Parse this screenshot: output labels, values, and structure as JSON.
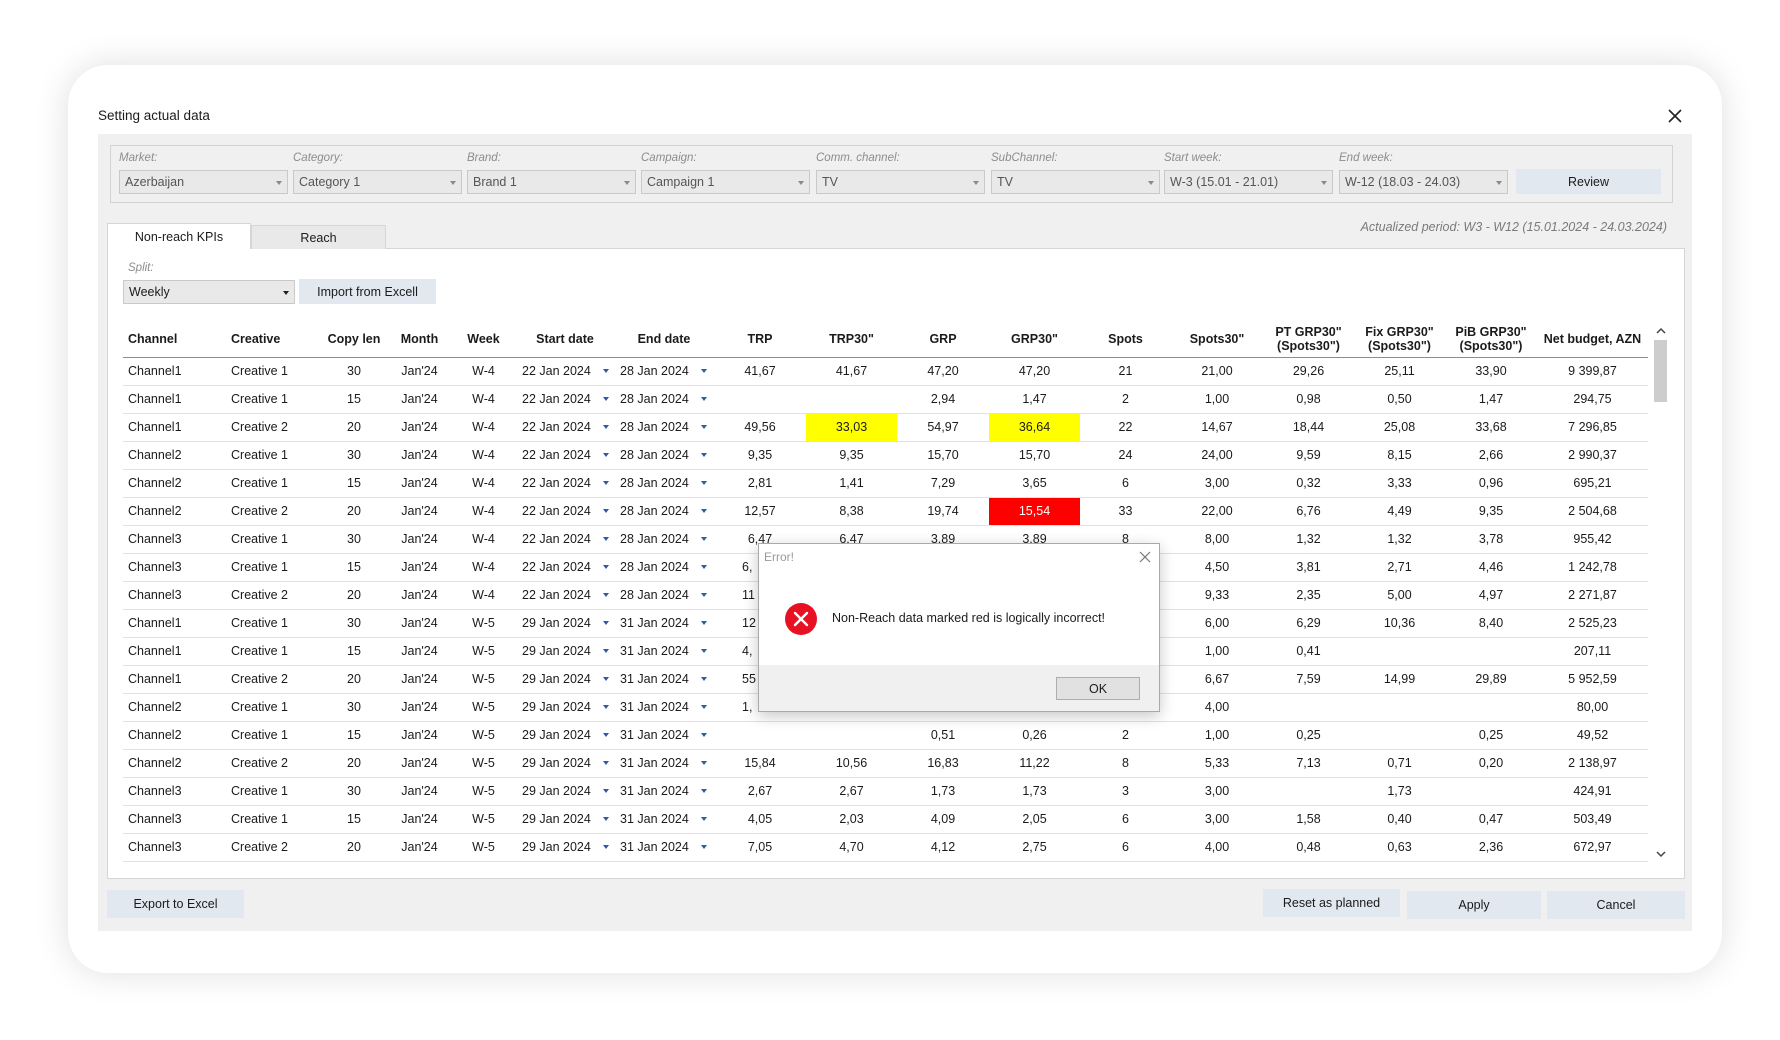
{
  "window": {
    "title": "Setting actual data"
  },
  "filters": [
    {
      "label": "Market:",
      "value": "Azerbaijan"
    },
    {
      "label": "Category:",
      "value": "Category 1"
    },
    {
      "label": "Brand:",
      "value": "Brand 1"
    },
    {
      "label": "Campaign:",
      "value": "Campaign 1"
    },
    {
      "label": "Comm. channel:",
      "value": "TV"
    },
    {
      "label": "SubChannel:",
      "value": "TV"
    },
    {
      "label": "Start week:",
      "value": "W-3 (15.01 - 21.01)"
    },
    {
      "label": "End week:",
      "value": "W-12 (18.03 - 24.03)"
    }
  ],
  "review_label": "Review",
  "tabs": [
    {
      "label": "Non-reach KPIs",
      "active": true
    },
    {
      "label": "Reach",
      "active": false
    }
  ],
  "actualized_period": "Actualized period: W3 - W12 (15.01.2024 - 24.03.2024)",
  "split": {
    "label": "Split:",
    "value": "Weekly"
  },
  "import_label": "Import from Excell",
  "table": {
    "columns": [
      "Channel",
      "Creative",
      "Copy len",
      "Month",
      "Week",
      "Start date",
      "End date",
      "TRP",
      "TRP30\"",
      "GRP",
      "GRP30\"",
      "Spots",
      "Spots30\"",
      "PT GRP30\"\n(Spots30\")",
      "Fix GRP30\"\n(Spots30\")",
      "PiB GRP30\"\n(Spots30\")",
      "Net budget, AZN"
    ],
    "rows": [
      [
        "Channel1",
        "Creative 1",
        "30",
        "Jan'24",
        "W-4",
        "22 Jan 2024",
        "28 Jan 2024",
        "41,67",
        "41,67",
        "47,20",
        "47,20",
        "21",
        "21,00",
        "29,26",
        "25,11",
        "33,90",
        "9 399,87"
      ],
      [
        "Channel1",
        "Creative 1",
        "15",
        "Jan'24",
        "W-4",
        "22 Jan 2024",
        "28 Jan 2024",
        "",
        "",
        "2,94",
        "1,47",
        "2",
        "1,00",
        "0,98",
        "0,50",
        "1,47",
        "294,75"
      ],
      [
        "Channel1",
        "Creative 2",
        "20",
        "Jan'24",
        "W-4",
        "22 Jan 2024",
        "28 Jan 2024",
        "49,56",
        "33,03",
        "54,97",
        "36,64",
        "22",
        "14,67",
        "18,44",
        "25,08",
        "33,68",
        "7 296,85"
      ],
      [
        "Channel2",
        "Creative 1",
        "30",
        "Jan'24",
        "W-4",
        "22 Jan 2024",
        "28 Jan 2024",
        "9,35",
        "9,35",
        "15,70",
        "15,70",
        "24",
        "24,00",
        "9,59",
        "8,15",
        "2,66",
        "2 990,37"
      ],
      [
        "Channel2",
        "Creative 1",
        "15",
        "Jan'24",
        "W-4",
        "22 Jan 2024",
        "28 Jan 2024",
        "2,81",
        "1,41",
        "7,29",
        "3,65",
        "6",
        "3,00",
        "0,32",
        "3,33",
        "0,96",
        "695,21"
      ],
      [
        "Channel2",
        "Creative 2",
        "20",
        "Jan'24",
        "W-4",
        "22 Jan 2024",
        "28 Jan 2024",
        "12,57",
        "8,38",
        "19,74",
        "15,54",
        "33",
        "22,00",
        "6,76",
        "4,49",
        "9,35",
        "2 504,68"
      ],
      [
        "Channel3",
        "Creative 1",
        "30",
        "Jan'24",
        "W-4",
        "22 Jan 2024",
        "28 Jan 2024",
        "6,47",
        "6,47",
        "3,89",
        "3,89",
        "8",
        "8,00",
        "1,32",
        "1,32",
        "3,78",
        "955,42"
      ],
      [
        "Channel3",
        "Creative 1",
        "15",
        "Jan'24",
        "W-4",
        "22 Jan 2024",
        "28 Jan 2024",
        "6,",
        "",
        "",
        "",
        "",
        "4,50",
        "3,81",
        "2,71",
        "4,46",
        "1 242,78"
      ],
      [
        "Channel3",
        "Creative 2",
        "20",
        "Jan'24",
        "W-4",
        "22 Jan 2024",
        "28 Jan 2024",
        "11",
        "",
        "",
        "",
        "",
        "9,33",
        "2,35",
        "5,00",
        "4,97",
        "2 271,87"
      ],
      [
        "Channel1",
        "Creative 1",
        "30",
        "Jan'24",
        "W-5",
        "29 Jan 2024",
        "31 Jan 2024",
        "12",
        "",
        "",
        "",
        "",
        "6,00",
        "6,29",
        "10,36",
        "8,40",
        "2 525,23"
      ],
      [
        "Channel1",
        "Creative 1",
        "15",
        "Jan'24",
        "W-5",
        "29 Jan 2024",
        "31 Jan 2024",
        "4,",
        "",
        "",
        "",
        "",
        "1,00",
        "0,41",
        "",
        "",
        "207,11"
      ],
      [
        "Channel1",
        "Creative 2",
        "20",
        "Jan'24",
        "W-5",
        "29 Jan 2024",
        "31 Jan 2024",
        "55",
        "",
        "",
        "",
        "",
        "6,67",
        "7,59",
        "14,99",
        "29,89",
        "5 952,59"
      ],
      [
        "Channel2",
        "Creative 1",
        "30",
        "Jan'24",
        "W-5",
        "29 Jan 2024",
        "31 Jan 2024",
        "1,",
        "",
        "",
        "",
        "",
        "4,00",
        "",
        "",
        "",
        "80,00"
      ],
      [
        "Channel2",
        "Creative 1",
        "15",
        "Jan'24",
        "W-5",
        "29 Jan 2024",
        "31 Jan 2024",
        "",
        "",
        "0,51",
        "0,26",
        "2",
        "1,00",
        "0,25",
        "",
        "0,25",
        "49,52"
      ],
      [
        "Channel2",
        "Creative 2",
        "20",
        "Jan'24",
        "W-5",
        "29 Jan 2024",
        "31 Jan 2024",
        "15,84",
        "10,56",
        "16,83",
        "11,22",
        "8",
        "5,33",
        "7,13",
        "0,71",
        "0,20",
        "2 138,97"
      ],
      [
        "Channel3",
        "Creative 1",
        "30",
        "Jan'24",
        "W-5",
        "29 Jan 2024",
        "31 Jan 2024",
        "2,67",
        "2,67",
        "1,73",
        "1,73",
        "3",
        "3,00",
        "",
        "1,73",
        "",
        "424,91"
      ],
      [
        "Channel3",
        "Creative 1",
        "15",
        "Jan'24",
        "W-5",
        "29 Jan 2024",
        "31 Jan 2024",
        "4,05",
        "2,03",
        "4,09",
        "2,05",
        "6",
        "3,00",
        "1,58",
        "0,40",
        "0,47",
        "503,49"
      ],
      [
        "Channel3",
        "Creative 2",
        "20",
        "Jan'24",
        "W-5",
        "29 Jan 2024",
        "31 Jan 2024",
        "7,05",
        "4,70",
        "4,12",
        "2,75",
        "6",
        "4,00",
        "0,48",
        "0,63",
        "2,36",
        "672,97"
      ]
    ]
  },
  "highlights": [
    {
      "row": 2,
      "col": 8,
      "color": "yellow"
    },
    {
      "row": 2,
      "col": 10,
      "color": "yellow"
    },
    {
      "row": 5,
      "col": 10,
      "color": "red"
    }
  ],
  "colors": {
    "yellow": "#ffff00",
    "red": "#ff0000",
    "error_icon": "#e81123"
  },
  "error_dialog": {
    "title": "Error!",
    "message": "Non-Reach data marked red is logically incorrect!",
    "ok_label": "OK"
  },
  "footer": {
    "export_label": "Export to Excel",
    "reset_label": "Reset as planned",
    "apply_label": "Apply",
    "cancel_label": "Cancel"
  }
}
